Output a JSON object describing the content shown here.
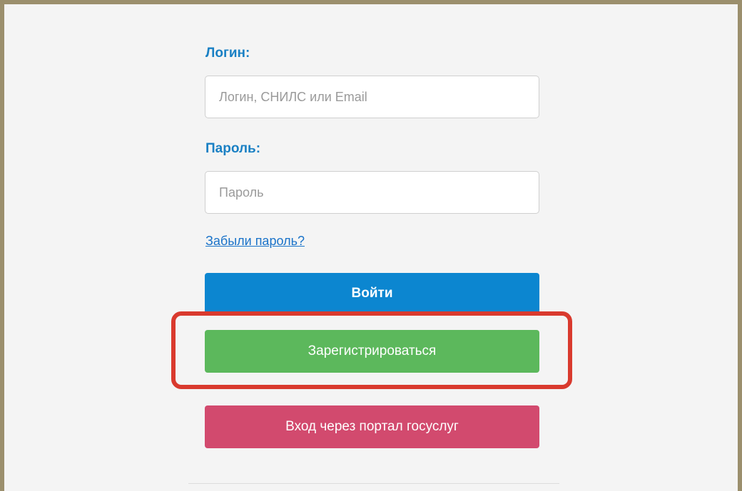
{
  "form": {
    "login_label": "Логин:",
    "login_placeholder": "Логин, СНИЛС или Email",
    "login_value": "",
    "password_label": "Пароль:",
    "password_placeholder": "Пароль",
    "password_value": "",
    "forgot_link": "Забыли пароль?",
    "login_button": "Войти",
    "register_button": "Зарегистрироваться",
    "gosuslugi_button": "Вход через портал госуслуг"
  },
  "colors": {
    "label": "#1a80c4",
    "link": "#1a73c9",
    "login_button": "#0c86d0",
    "register_button": "#5cb85c",
    "gosuslugi_button": "#d24a6e",
    "highlight_outline": "#d93a2e",
    "frame_border": "#9b8f6d"
  }
}
